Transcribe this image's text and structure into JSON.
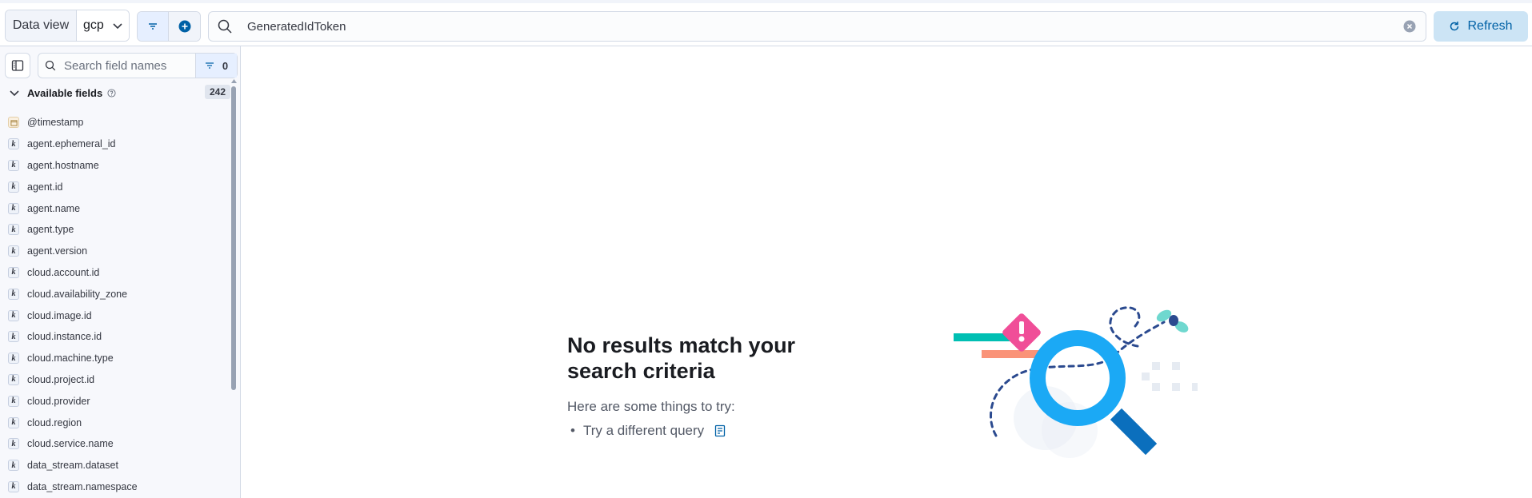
{
  "topbar": {
    "data_view_label": "Data view",
    "data_view_value": "gcp",
    "query_text": "GeneratedIdToken",
    "refresh_label": "Refresh"
  },
  "sidebar": {
    "search_placeholder": "Search field names",
    "filter_count": "0",
    "section_title": "Available fields",
    "section_count": "242",
    "fields": [
      {
        "name": "@timestamp",
        "type": "date"
      },
      {
        "name": "agent.ephemeral_id",
        "type": "keyword"
      },
      {
        "name": "agent.hostname",
        "type": "keyword"
      },
      {
        "name": "agent.id",
        "type": "keyword"
      },
      {
        "name": "agent.name",
        "type": "keyword"
      },
      {
        "name": "agent.type",
        "type": "keyword"
      },
      {
        "name": "agent.version",
        "type": "keyword"
      },
      {
        "name": "cloud.account.id",
        "type": "keyword"
      },
      {
        "name": "cloud.availability_zone",
        "type": "keyword"
      },
      {
        "name": "cloud.image.id",
        "type": "keyword"
      },
      {
        "name": "cloud.instance.id",
        "type": "keyword"
      },
      {
        "name": "cloud.machine.type",
        "type": "keyword"
      },
      {
        "name": "cloud.project.id",
        "type": "keyword"
      },
      {
        "name": "cloud.provider",
        "type": "keyword"
      },
      {
        "name": "cloud.region",
        "type": "keyword"
      },
      {
        "name": "cloud.service.name",
        "type": "keyword"
      },
      {
        "name": "data_stream.dataset",
        "type": "keyword"
      },
      {
        "name": "data_stream.namespace",
        "type": "keyword"
      }
    ],
    "keyword_glyph": "k"
  },
  "empty_state": {
    "title": "No results match your search criteria",
    "subtitle": "Here are some things to try:",
    "suggestions": [
      "Try a different query"
    ]
  },
  "colors": {
    "accent": "#0077cc",
    "refresh_bg": "#cce4f5",
    "illustration_blue": "#1ba9f5",
    "illustration_pink": "#f04e98",
    "illustration_teal": "#00bfb3",
    "illustration_salmon": "#fa9378"
  }
}
